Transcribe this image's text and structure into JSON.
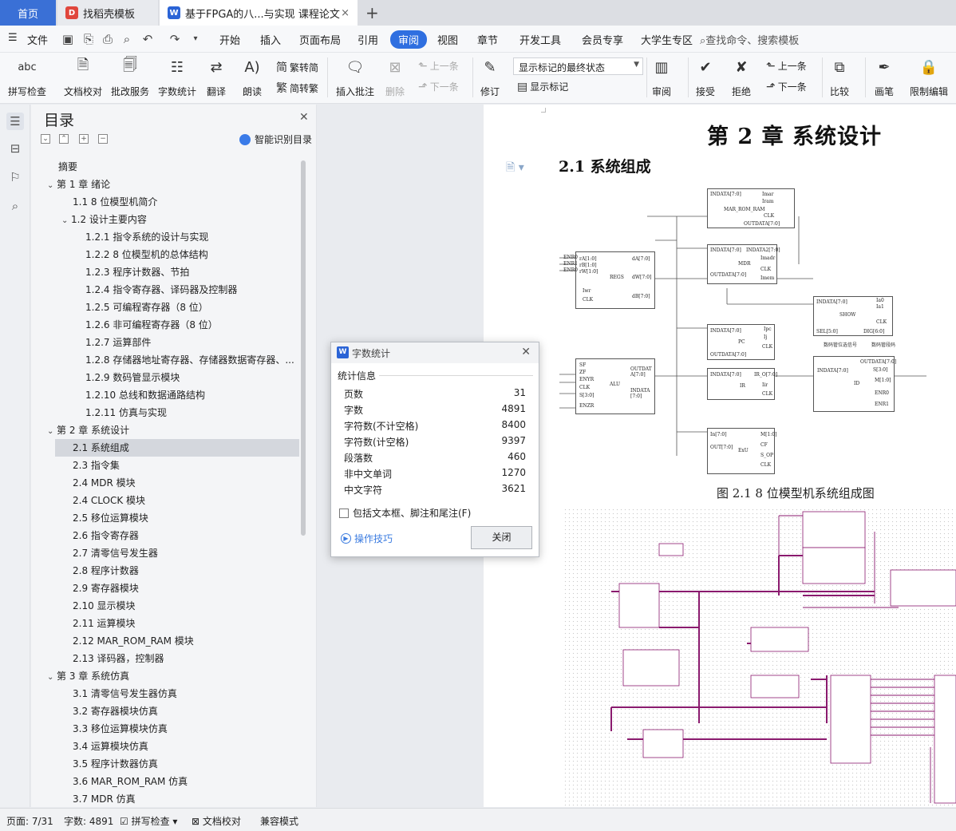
{
  "tabs": {
    "home": "首页",
    "template": "找稻壳模板",
    "doc": "基于FPGA的八...与实现 课程论文",
    "add": "+",
    "close": "×"
  },
  "menu": {
    "file": "文件",
    "items": [
      "开始",
      "插入",
      "页面布局",
      "引用",
      "审阅",
      "视图",
      "章节",
      "开发工具",
      "会员专享",
      "大学生专区"
    ],
    "search": "查找命令、搜索模板"
  },
  "ribbon": {
    "spell": "拼写检查",
    "proof": "文档校对",
    "annotate_service": "批改服务",
    "word_count": "字数统计",
    "translate": "翻译",
    "read": "朗读",
    "to_trad": "繁转简",
    "to_simp": "简转繁",
    "insert_comment": "插入批注",
    "delete": "删除",
    "prev_comment": "上一条",
    "next_comment": "下一条",
    "revise": "修订",
    "markup_state": "显示标记的最终状态",
    "show_markup": "显示标记",
    "review": "审阅",
    "accept": "接受",
    "reject": "拒绝",
    "prev": "上一条",
    "next": "下一条",
    "compare": "比较",
    "pen": "画笔",
    "restrict": "限制编辑"
  },
  "toc": {
    "title": "目录",
    "smart": "智能识别目录",
    "items": [
      {
        "text": "摘要",
        "level": 0,
        "caret": ""
      },
      {
        "text": "第 1 章  绪论",
        "level": 0,
        "caret": "v"
      },
      {
        "text": "1.1 8 位模型机简介",
        "level": 1,
        "caret": ""
      },
      {
        "text": "1.2 设计主要内容",
        "level": 1,
        "caret": "v"
      },
      {
        "text": "1.2.1  指令系统的设计与实现",
        "level": 2,
        "caret": ""
      },
      {
        "text": "1.2.2 8 位模型机的总体结构",
        "level": 2,
        "caret": ""
      },
      {
        "text": "1.2.3  程序计数器、节拍",
        "level": 2,
        "caret": ""
      },
      {
        "text": "1.2.4  指令寄存器、译码器及控制器",
        "level": 2,
        "caret": ""
      },
      {
        "text": "1.2.5  可编程寄存器（8 位）",
        "level": 2,
        "caret": ""
      },
      {
        "text": "1.2.6  非可编程寄存器（8 位）",
        "level": 2,
        "caret": ""
      },
      {
        "text": "1.2.7  运算部件",
        "level": 2,
        "caret": ""
      },
      {
        "text": "1.2.8  存储器地址寄存器、存储器数据寄存器、...",
        "level": 2,
        "caret": ""
      },
      {
        "text": "1.2.9  数码管显示模块",
        "level": 2,
        "caret": ""
      },
      {
        "text": "1.2.10  总线和数据通路结构",
        "level": 2,
        "caret": ""
      },
      {
        "text": "1.2.11  仿真与实现",
        "level": 2,
        "caret": ""
      },
      {
        "text": "第 2 章  系统设计",
        "level": 0,
        "caret": "v"
      },
      {
        "text": "2.1 系统组成",
        "level": 1,
        "caret": "",
        "selected": true
      },
      {
        "text": "2.3  指令集",
        "level": 1,
        "caret": ""
      },
      {
        "text": "2.4 MDR 模块",
        "level": 1,
        "caret": ""
      },
      {
        "text": "2.4 CLOCK 模块",
        "level": 1,
        "caret": ""
      },
      {
        "text": "2.5  移位运算模块",
        "level": 1,
        "caret": ""
      },
      {
        "text": "2.6  指令寄存器",
        "level": 1,
        "caret": ""
      },
      {
        "text": "2.7  清零信号发生器",
        "level": 1,
        "caret": ""
      },
      {
        "text": "2.8  程序计数器",
        "level": 1,
        "caret": ""
      },
      {
        "text": "2.9  寄存器模块",
        "level": 1,
        "caret": ""
      },
      {
        "text": "2.10  显示模块",
        "level": 1,
        "caret": ""
      },
      {
        "text": "2.11  运算模块",
        "level": 1,
        "caret": ""
      },
      {
        "text": "2.12 MAR_ROM_RAM 模块",
        "level": 1,
        "caret": ""
      },
      {
        "text": "2.13  译码器，控制器",
        "level": 1,
        "caret": ""
      },
      {
        "text": "第 3 章  系统仿真",
        "level": 0,
        "caret": "v"
      },
      {
        "text": "3.1  清零信号发生器仿真",
        "level": 1,
        "caret": ""
      },
      {
        "text": "3.2  寄存器模块仿真",
        "level": 1,
        "caret": ""
      },
      {
        "text": "3.3  移位运算模块仿真",
        "level": 1,
        "caret": ""
      },
      {
        "text": "3.4  运算模块仿真",
        "level": 1,
        "caret": ""
      },
      {
        "text": "3.5 程序计数器仿真",
        "level": 1,
        "caret": ""
      },
      {
        "text": "3.6 MAR_ROM_RAM 仿真",
        "level": 1,
        "caret": ""
      },
      {
        "text": "3.7 MDR 仿真",
        "level": 1,
        "caret": ""
      }
    ]
  },
  "document": {
    "chapter": "第 2 章  系统设计",
    "section": "2.1 系统组成",
    "caption": "图 2.1  8 位模型机系统组成图",
    "blocks": {
      "mar": [
        "INDATA[7:0]",
        "Imar",
        "Iram",
        "MAR_ROM_RAM",
        "CLK",
        "OUTDATA[7:0]"
      ],
      "mdr": [
        "INDATA[7:0]",
        "INDATA2[7:0]",
        "Imadr",
        "MDR",
        "CLK",
        "OUTDATA[7:0]",
        "Imem"
      ],
      "regs": [
        "ENR0",
        "ENR1",
        "ENR0",
        "rA[1:0]",
        "rB[1:0]",
        "rW[1:0]",
        "REGS",
        "dA[7:0]",
        "dW[7:0]",
        "Iwr",
        "CLK",
        "dB[7:0]"
      ],
      "show": [
        "INDATA[7:0]",
        "Ia0",
        "Ia1",
        "SHOW",
        "CLK",
        "SEL[5:0]",
        "DIG[6:0]",
        "数码管位选信号",
        "数码管段码"
      ],
      "pc": [
        "INDATA[7:0]",
        "Ipc",
        "PC",
        "Ij",
        "CLK",
        "OUTDATA[7:0]"
      ],
      "ir": [
        "INDATA[7:0]",
        "IR_O[7:0]",
        "IR",
        "Iir",
        "CLK"
      ],
      "alu": [
        "SF",
        "ZF",
        "ENYR",
        "CLK",
        "S[3:0]",
        "ENZR",
        "ALU",
        "OUTDAT A[7:0]",
        "INDATA [7:0]"
      ],
      "id": [
        "INDATA[7:0]",
        "OUTDATA[7:0]",
        "S[3:0]",
        "ID",
        "M[1:0]",
        "ENR0",
        "ENR1"
      ],
      "exu": [
        "In[7:0]",
        "M[1:0]",
        "OUT[7:0]",
        "ExU",
        "CF",
        "S_OP",
        "CLK"
      ]
    }
  },
  "dialog": {
    "title": "字数统计",
    "subtitle": "统计信息",
    "rows": [
      {
        "label": "页数",
        "value": "31"
      },
      {
        "label": "字数",
        "value": "4891"
      },
      {
        "label": "字符数(不计空格)",
        "value": "8400"
      },
      {
        "label": "字符数(计空格)",
        "value": "9397"
      },
      {
        "label": "段落数",
        "value": "460"
      },
      {
        "label": "非中文单词",
        "value": "1270"
      },
      {
        "label": "中文字符",
        "value": "3621"
      }
    ],
    "include": "包括文本框、脚注和尾注(F)",
    "tips": "操作技巧",
    "close": "关闭"
  },
  "status": {
    "page": "页面: 7/31",
    "words": "字数: 4891",
    "spell": "拼写检查",
    "proof": "文档校对",
    "compat": "兼容模式"
  },
  "colors": {
    "accent": "#2f6fe0",
    "home_tab": "#3a70d6",
    "schematic_bus": "#8a1a6e"
  }
}
